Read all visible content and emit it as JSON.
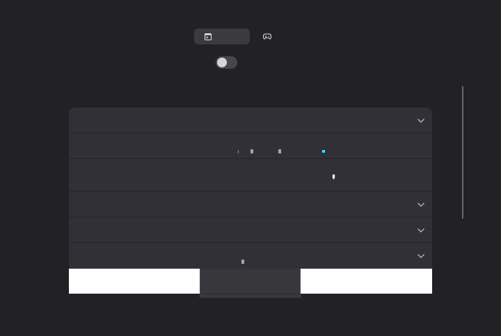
{
  "view_switcher": {
    "tabs": [
      {
        "name": "terminal-view",
        "icon": "terminal-window-icon",
        "active": true
      },
      {
        "name": "gamepad-view",
        "icon": "gamepad-icon",
        "active": false
      }
    ]
  },
  "toggle": {
    "state": "off"
  },
  "settings_rows": [
    {
      "name": "row-1",
      "expandable": true
    },
    {
      "name": "row-2",
      "expandable": false
    },
    {
      "name": "row-3",
      "expandable": false
    },
    {
      "name": "row-4",
      "expandable": true
    },
    {
      "name": "row-5",
      "expandable": true
    },
    {
      "name": "row-6",
      "expandable": true
    }
  ],
  "colors": {
    "background": "#222226",
    "card": "#303036",
    "accent": "#40e0e8"
  }
}
